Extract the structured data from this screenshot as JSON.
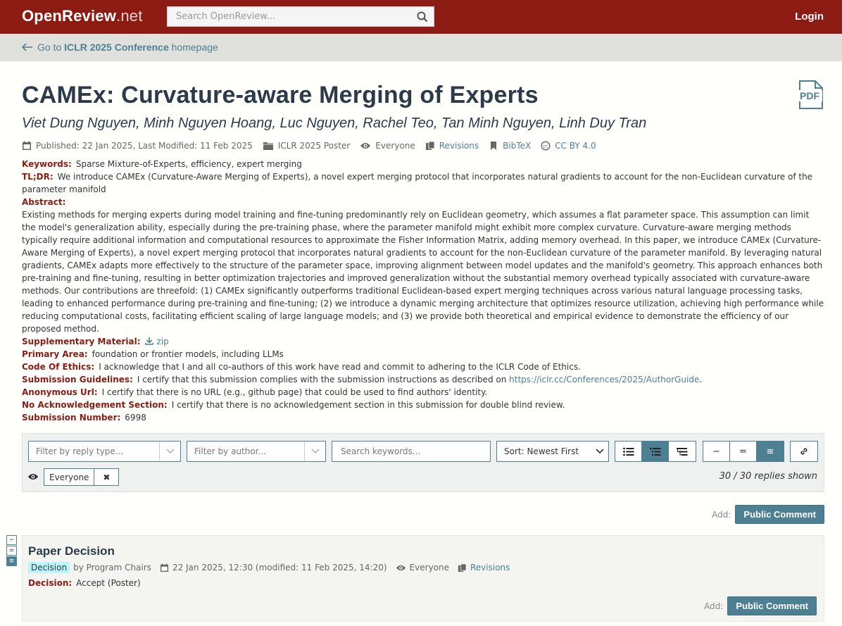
{
  "nav": {
    "logo_main": "OpenReview",
    "logo_suffix": ".net",
    "search_placeholder": "Search OpenReview...",
    "login_label": "Login"
  },
  "breadcrumb": {
    "prefix": "Go to ",
    "venue": "ICLR 2025 Conference",
    "suffix": " homepage"
  },
  "paper": {
    "title": "CAMEx: Curvature-aware Merging of Experts",
    "authors": "Viet Dung Nguyen, Minh Nguyen Hoang, Luc Nguyen, Rachel Teo, Tan Minh Nguyen, Linh Duy Tran",
    "pdf_label": "PDF",
    "meta": {
      "dates": "Published: 22 Jan 2025, Last Modified: 11 Feb 2025",
      "venue": "ICLR 2025 Poster",
      "readers": "Everyone",
      "revisions": "Revisions",
      "bibtex": "BibTeX",
      "license": "CC BY 4.0"
    },
    "fields": {
      "keywords_label": "Keywords:",
      "keywords": "Sparse Mixture-of-Experts, efficiency, expert merging",
      "tldr_label": "TL;DR:",
      "tldr": "We introduce CAMEx (Curvature-Aware Merging of Experts), a novel expert merging protocol that incorporates natural gradients to account for the non-Euclidean curvature of the parameter manifold",
      "abstract_label": "Abstract:",
      "abstract": "Existing methods for merging experts during model training and fine-tuning predominantly rely on Euclidean geometry, which assumes a flat parameter space. This assumption can limit the model's generalization ability, especially during the pre-training phase, where the parameter manifold might exhibit more complex curvature. Curvature-aware merging methods typically require additional information and computational resources to approximate the Fisher Information Matrix, adding memory overhead. In this paper, we introduce CAMEx (Curvature-Aware Merging of Experts), a novel expert merging protocol that incorporates natural gradients to account for the non-Euclidean curvature of the parameter manifold. By leveraging natural gradients, CAMEx adapts more effectively to the structure of the parameter space, improving alignment between model updates and the manifold's geometry. This approach enhances both pre-training and fine-tuning, resulting in better optimization trajectories and improved generalization without the substantial memory overhead typically associated with curvature-aware methods. Our contributions are threefold: (1) CAMEx significantly outperforms traditional Euclidean-based expert merging techniques across various natural language processing tasks, leading to enhanced performance during pre-training and fine-tuning; (2) we introduce a dynamic merging architecture that optimizes resource utilization, achieving high performance while reducing computational costs, facilitating efficient scaling of large language models; and (3) we provide both theoretical and empirical evidence to demonstrate the efficiency of our proposed method.",
      "supp_label": "Supplementary Material:",
      "supp_link": "zip",
      "primary_area_label": "Primary Area:",
      "primary_area": "foundation or frontier models, including LLMs",
      "ethics_label": "Code Of Ethics:",
      "ethics": "I acknowledge that I and all co-authors of this work have read and commit to adhering to the ICLR Code of Ethics.",
      "guidelines_label": "Submission Guidelines:",
      "guidelines_prefix": "I certify that this submission complies with the submission instructions as described on ",
      "guidelines_link": "https://iclr.cc/Conferences/2025/AuthorGuide",
      "guidelines_suffix": ".",
      "anon_label": "Anonymous Url:",
      "anon": "I certify that there is no URL (e.g., github page) that could be used to find authors' identity.",
      "noack_label": "No Acknowledgement Section:",
      "noack": "I certify that there is no acknowledgement section in this submission for double blind review.",
      "number_label": "Submission Number:",
      "number": "6998"
    }
  },
  "filters": {
    "reply_type_placeholder": "Filter by reply type...",
    "author_placeholder": "Filter by author...",
    "keyword_placeholder": "Search keywords...",
    "sort_label": "Sort: Newest First",
    "readers_chip": "Everyone",
    "chip_remove": "✖",
    "replies_shown": "30 / 30 replies shown"
  },
  "add": {
    "label": "Add:",
    "button": "Public Comment"
  },
  "note": {
    "title": "Paper Decision",
    "invitation_badge": "Decision",
    "signature": "by Program Chairs",
    "date": "22 Jan 2025, 12:30 (modified: 11 Feb 2025, 14:20)",
    "readers": "Everyone",
    "revisions": "Revisions",
    "decision_label": "Decision:",
    "decision": "Accept (Poster)",
    "add_label": "Add:",
    "add_button": "Public Comment"
  }
}
